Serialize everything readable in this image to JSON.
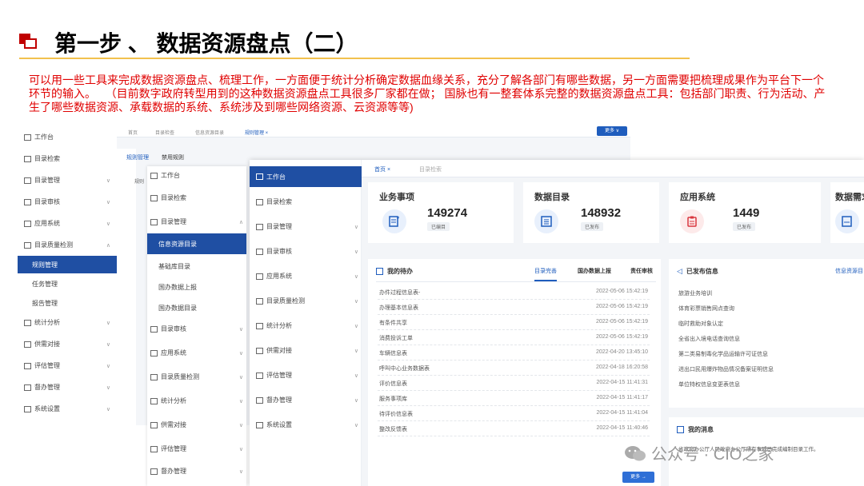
{
  "header": {
    "title": "第一步 、 数据资源盘点（二）"
  },
  "intro": {
    "red1": "可以用一些工具来完成数据资源盘点、梳理工作，一方面便于统计分析确定数据血缘关系，充分了解各部门有哪些数据，另一方面需要把梳理成果作为平台下一个环节的输入。",
    "red2": "（目前数字政府转型用到的这种数据资源盘点工具很多厂家都在做； 国脉也有一整套体系完整的数据资源盘点工具：包括部门职责、行为活动、产生了哪些数据资源、承载数据的系统、系统涉及到哪些网络资源、云资源等等)"
  },
  "screen1": {
    "sidebar": [
      "工作台",
      "目录检索",
      "目录管理",
      "目录审核",
      "应用系统",
      "目录质量检测",
      "规则管理",
      "任务管理",
      "报告管理",
      "统计分析",
      "供需对接",
      "评估管理",
      "督办管理",
      "系统设置"
    ],
    "top_tabs": [
      "首页",
      "目录检查",
      "信息资源目录",
      "规则管理 ×"
    ],
    "more": "更多 ∨",
    "sub_tabs": [
      "规则管理",
      "禁用规则"
    ],
    "rule_label": "规则"
  },
  "screen2": {
    "items": [
      "工作台",
      "目录检索",
      "目录管理",
      "信息资源目录",
      "基础库目录",
      "国办数据上报",
      "国办数据目录",
      "目录审核",
      "应用系统",
      "目录质量检测",
      "统计分析",
      "供需对接",
      "评估管理",
      "督办管理"
    ]
  },
  "screen3": {
    "sidebar": [
      "工作台",
      "目录检索",
      "目录管理",
      "目录审核",
      "应用系统",
      "目录质量检测",
      "统计分析",
      "供需对接",
      "评估管理",
      "督办管理",
      "系统设置"
    ],
    "tabs": [
      "首页 ×",
      "目录检索"
    ],
    "cards": [
      {
        "label": "业务事项",
        "value": "149274",
        "badge": "已编目",
        "color": "#1f5dbd",
        "bg": "#e8f0fc"
      },
      {
        "label": "数据目录",
        "value": "148932",
        "badge": "已发布",
        "color": "#1f5dbd",
        "bg": "#e8f0fc"
      },
      {
        "label": "应用系统",
        "value": "1449",
        "badge": "已发布",
        "color": "#d9363e",
        "bg": "#fdeaea"
      },
      {
        "label": "数据需求",
        "value": "",
        "badge": "",
        "color": "#1f5dbd",
        "bg": "#e8f0fc"
      }
    ],
    "todo": {
      "title": "我的待办",
      "tabs": [
        "目录完善",
        "国办数据上报",
        "责任审核"
      ],
      "rows": [
        {
          "name": "办件过程信息表-",
          "time": "2022-05-06 15:42:19"
        },
        {
          "name": "办理基本信息表",
          "time": "2022-05-06 15:42:19"
        },
        {
          "name": "有条件共享",
          "time": "2022-05-06 15:42:19"
        },
        {
          "name": "消费投诉工单",
          "time": "2022-05-06 15:42:19"
        },
        {
          "name": "车辆信息表",
          "time": "2022-04-20 13:45:10"
        },
        {
          "name": "呼叫中心业务数据表",
          "time": "2022-04-18 16:20:58"
        },
        {
          "name": "评价信息表",
          "time": "2022-04-15 11:41:31"
        },
        {
          "name": "服务事项库",
          "time": "2022-04-15 11:41:17"
        },
        {
          "name": "待评价信息表",
          "time": "2022-04-15 11:41:04"
        },
        {
          "name": "整改反馈表",
          "time": "2022-04-15 11:40:46"
        }
      ],
      "more": "更多 →"
    },
    "published": {
      "title": "已发布信息",
      "link": "信息资源目",
      "rows": [
        "旅游业务培训",
        "体育彩票销售网点查询",
        "临时救助对象认定",
        "全省出入境电话查询信息",
        "第二类易制毒化学品运输许可证信息",
        "进出口民用爆炸物品情况备案证明信息",
        "单位特权信息变更表信息"
      ]
    },
    "messages": {
      "title": "我的消息",
      "text": "省政府办公厅人民政府办公厅所有事项已完成编制目录工作。"
    }
  },
  "watermark": "公众号 · CIO之家"
}
